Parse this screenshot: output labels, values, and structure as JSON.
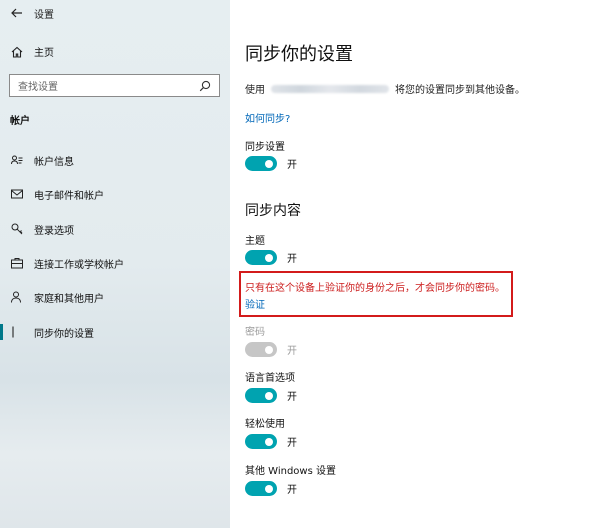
{
  "colors": {
    "accent": "#00a3b0",
    "link": "#0067b8",
    "warning": "#d31b1b",
    "disabled": "#c6c6c6"
  },
  "titlebar": {
    "back_icon": "arrow-left-icon",
    "title": "设置"
  },
  "sidebar": {
    "home": {
      "icon": "home-icon",
      "label": "主页"
    },
    "search": {
      "placeholder": "查找设置",
      "icon": "search-icon"
    },
    "section_title": "帐户",
    "items": [
      {
        "icon": "person-card-icon",
        "label": "帐户信息"
      },
      {
        "icon": "mail-icon",
        "label": "电子邮件和帐户"
      },
      {
        "icon": "key-icon",
        "label": "登录选项"
      },
      {
        "icon": "briefcase-icon",
        "label": "连接工作或学校帐户"
      },
      {
        "icon": "person-add-icon",
        "label": "家庭和其他用户"
      },
      {
        "icon": "sync-icon",
        "label": "同步你的设置",
        "active": true
      }
    ]
  },
  "main": {
    "title": "同步你的设置",
    "desc_prefix": "使用",
    "desc_suffix": "将您的设置同步到其他设备。",
    "how_link": "如何同步?",
    "sync_setting": {
      "label": "同步设置",
      "state": "开",
      "on": true
    },
    "sync_content_header": "同步内容",
    "theme": {
      "label": "主题",
      "state": "开",
      "on": true
    },
    "warning_text": "只有在这个设备上验证你的身份之后，才会同步你的密码。",
    "verify_link": "验证",
    "password": {
      "label": "密码",
      "state": "开",
      "disabled": true
    },
    "language": {
      "label": "语言首选项",
      "state": "开",
      "on": true
    },
    "ease": {
      "label": "轻松使用",
      "state": "开",
      "on": true
    },
    "other": {
      "label": "其他 Windows 设置",
      "state": "开",
      "on": true
    }
  }
}
